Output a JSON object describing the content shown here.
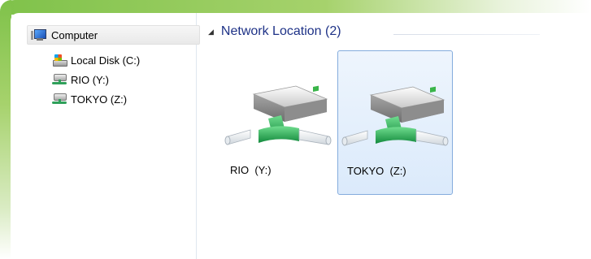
{
  "nav": {
    "items": [
      {
        "label": "Computer",
        "icon": "computer-icon",
        "selected": true
      },
      {
        "label": "Local Disk (C:)",
        "icon": "local-disk-icon"
      },
      {
        "label": "RIO  (Y:)",
        "icon": "network-drive-icon"
      },
      {
        "label": "TOKYO (Z:)",
        "icon": "network-drive-icon"
      }
    ]
  },
  "content": {
    "group_title": "Network Location (2)",
    "items": [
      {
        "label": "RIO  (Y:)",
        "icon": "network-drive-icon",
        "selected": false
      },
      {
        "label": "TOKYO  (Z:)",
        "icon": "network-drive-icon",
        "selected": true
      }
    ]
  },
  "colors": {
    "accent_green": "#7fc24a",
    "header_text": "#1e3287",
    "selection_border": "#84acdd"
  }
}
